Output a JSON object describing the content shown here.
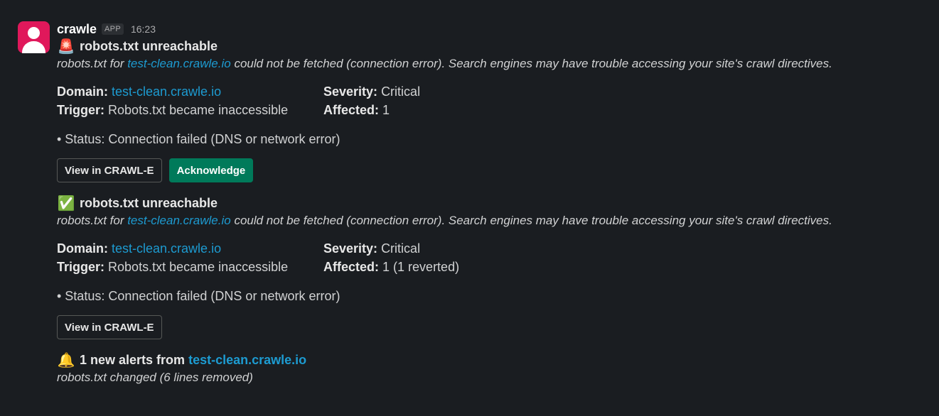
{
  "message": {
    "sender": "crawle",
    "app_badge": "APP",
    "time": "16:23"
  },
  "alert1": {
    "title_emoji": "🚨",
    "title": "robots.txt unreachable",
    "desc_prefix": "robots.txt for ",
    "desc_link": "test-clean.crawle.io",
    "desc_suffix": " could not be fetched (connection error). Search engines may have trouble accessing your site's crawl directives.",
    "domain_label": "Domain:",
    "domain_value": "test-clean.crawle.io",
    "severity_label": "Severity:",
    "severity_value": "Critical",
    "trigger_label": "Trigger:",
    "trigger_value": "Robots.txt became inaccessible",
    "affected_label": "Affected:",
    "affected_value": "1",
    "status": "• Status: Connection failed (DNS or network error)",
    "view_button": "View in CRAWL-E",
    "ack_button": "Acknowledge"
  },
  "alert2": {
    "title_emoji": "✅",
    "title": "robots.txt unreachable",
    "desc_prefix": "robots.txt for ",
    "desc_link": "test-clean.crawle.io",
    "desc_suffix": " could not be fetched (connection error). Search engines may have trouble accessing your site's crawl directives.",
    "domain_label": "Domain:",
    "domain_value": "test-clean.crawle.io",
    "severity_label": "Severity:",
    "severity_value": "Critical",
    "trigger_label": "Trigger:",
    "trigger_value": "Robots.txt became inaccessible",
    "affected_label": "Affected:",
    "affected_value": "1 (1 reverted)",
    "status": "• Status: Connection failed (DNS or network error)",
    "view_button": "View in CRAWL-E"
  },
  "alert3": {
    "title_emoji": "🔔",
    "title_prefix": "1 new alerts from ",
    "title_link": "test-clean.crawle.io",
    "desc": "robots.txt changed (6 lines removed)"
  },
  "colors": {
    "background": "#1a1d21",
    "link": "#1d9bd1",
    "primary_button": "#007a5a",
    "avatar": "#e0185b"
  }
}
